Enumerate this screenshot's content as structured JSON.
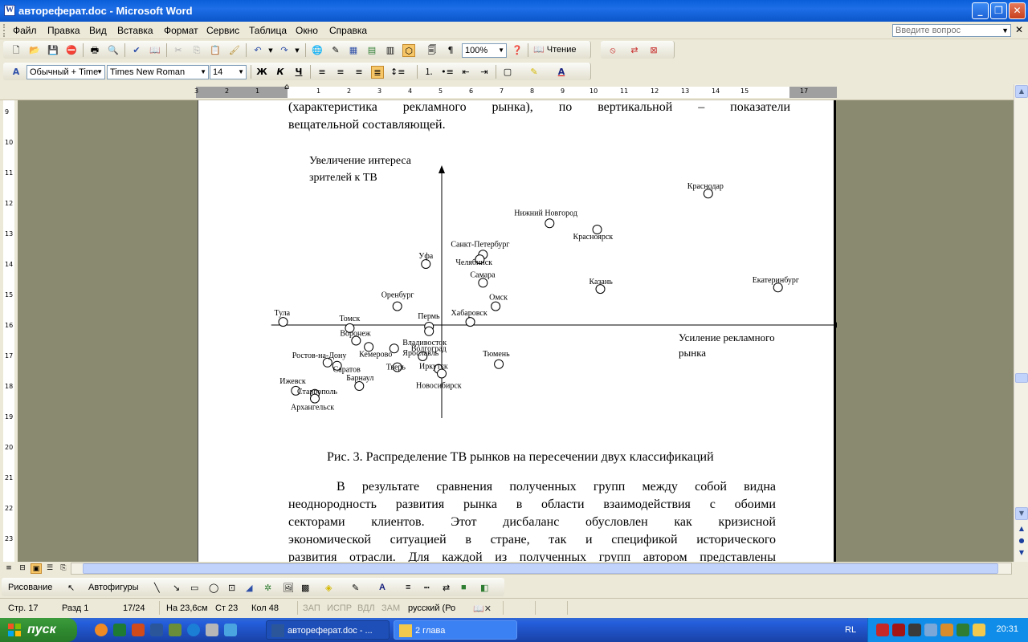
{
  "window": {
    "title": "автореферат.doc - Microsoft Word"
  },
  "menu": {
    "items": [
      "Файл",
      "Правка",
      "Вид",
      "Вставка",
      "Формат",
      "Сервис",
      "Таблица",
      "Окно",
      "Справка"
    ],
    "help_placeholder": "Введите вопрос"
  },
  "toolbar": {
    "zoom": "100%",
    "read_label": "Чтение",
    "style": "Обычный + Time",
    "font": "Times New Roman",
    "size": "14",
    "bold": "Ж",
    "italic": "К",
    "underline": "Ч"
  },
  "ruler": {
    "h_ticks": [
      "3",
      "2",
      "1",
      "1",
      "2",
      "3",
      "4",
      "5",
      "6",
      "7",
      "8",
      "9",
      "10",
      "11",
      "12",
      "13",
      "14",
      "15",
      "17"
    ],
    "v_ticks": [
      "9",
      "10",
      "11",
      "12",
      "13",
      "14",
      "15",
      "16",
      "17",
      "18",
      "19",
      "20",
      "21",
      "22",
      "23"
    ]
  },
  "document": {
    "top_line1": "(характеристика рекламного рынка), по вертикальной – показатели",
    "top_line2": "вещательной составляющей.",
    "caption": "Рис. 3. Распределение ТВ рынков на пересечении двух классификаций",
    "para_lines": [
      "В результате сравнения полученных групп между собой видна",
      "неоднородность развития рынка в области взаимодействия с обоими",
      "секторами клиентов. Этот дисбаланс обусловлен как кризисной",
      "экономической ситуацией в стране, так и спецификой исторического",
      "развития отрасли. Для каждой из полученных групп автором представлены"
    ]
  },
  "chart_data": {
    "type": "scatter",
    "ylabel_lines": [
      "Увеличение интереса",
      "зрителей к ТВ"
    ],
    "xlabel_lines": [
      "Усиление рекламного",
      "рынка"
    ],
    "xlim": [
      -5.5,
      12.5
    ],
    "ylim": [
      -6,
      10
    ],
    "grid": false,
    "points": [
      {
        "label": "Краснодар",
        "x": 8.4,
        "y": 8.4
      },
      {
        "label": "Нижний Новгород",
        "x": 3.4,
        "y": 6.5
      },
      {
        "label": "Красноярск",
        "x": 4.9,
        "y": 6.1
      },
      {
        "label": "Санкт-Петербург",
        "x": 1.3,
        "y": 4.5
      },
      {
        "label": "Челябинск",
        "x": 1.2,
        "y": 4.2
      },
      {
        "label": "Уфа",
        "x": -0.5,
        "y": 3.9
      },
      {
        "label": "Самара",
        "x": 1.3,
        "y": 2.7
      },
      {
        "label": "Казань",
        "x": 5.0,
        "y": 2.3
      },
      {
        "label": "Екатеринбург",
        "x": 10.6,
        "y": 2.4
      },
      {
        "label": "Омск",
        "x": 1.7,
        "y": 1.2
      },
      {
        "label": "Оренбург",
        "x": -1.4,
        "y": 1.2
      },
      {
        "label": "Тула",
        "x": -5.0,
        "y": 0.2
      },
      {
        "label": "Хабаровск",
        "x": 0.9,
        "y": 0.2
      },
      {
        "label": "Пермь",
        "x": -0.4,
        "y": -0.1
      },
      {
        "label": "Томск",
        "x": -2.9,
        "y": -0.2
      },
      {
        "label": "Владивосток",
        "x": -0.4,
        "y": -0.4
      },
      {
        "label": "Воронеж",
        "x": -2.7,
        "y": -1.0
      },
      {
        "label": "Волгоград",
        "x": -1.5,
        "y": -1.5
      },
      {
        "label": "Кемерово",
        "x": -2.3,
        "y": -1.4
      },
      {
        "label": "Ярославль",
        "x": -0.6,
        "y": -2.0
      },
      {
        "label": "Тюмень",
        "x": 1.8,
        "y": -2.5
      },
      {
        "label": "Ростов-на-Дону",
        "x": -3.6,
        "y": -2.4
      },
      {
        "label": "Саратов",
        "x": -3.3,
        "y": -2.6
      },
      {
        "label": "Тверь",
        "x": -1.4,
        "y": -2.7
      },
      {
        "label": "Иркутск",
        "x": -0.1,
        "y": -2.8
      },
      {
        "label": "Новосибирск",
        "x": 0.0,
        "y": -3.1
      },
      {
        "label": "Барнаул",
        "x": -2.6,
        "y": -3.9
      },
      {
        "label": "Ижевск",
        "x": -4.6,
        "y": -4.2
      },
      {
        "label": "Ставрополь",
        "x": -4.0,
        "y": -4.4
      },
      {
        "label": "Архангельск",
        "x": -4.0,
        "y": -4.7
      }
    ]
  },
  "status": {
    "page": "Стр. 17",
    "section": "Разд 1",
    "pages": "17/24",
    "at": "На 23,6см",
    "line": "Ст 23",
    "col": "Кол 48",
    "rec": "ЗАП",
    "trk": "ИСПР",
    "ext": "ВДЛ",
    "ovr": "ЗАМ",
    "lang": "русский (Ро"
  },
  "drawing": {
    "draw_label": "Рисование",
    "autoshapes_label": "Автофигуры"
  },
  "taskbar": {
    "start_label": "пуск",
    "tasks": [
      "автореферат.doc - ...",
      "2 глава"
    ],
    "lang": "RL",
    "clock": "20:31"
  }
}
